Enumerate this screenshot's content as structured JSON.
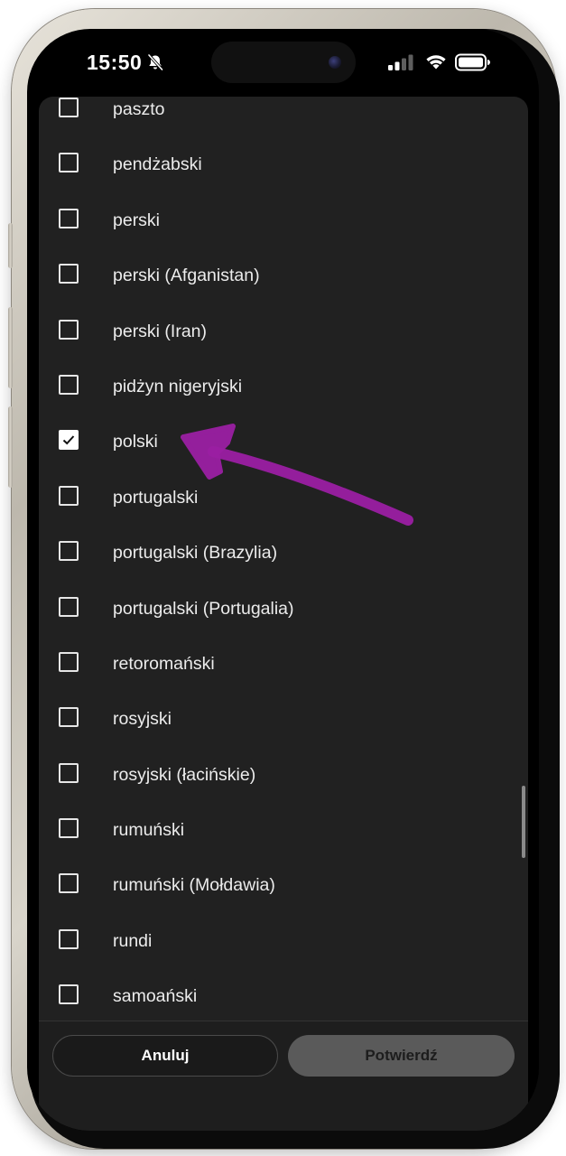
{
  "status_bar": {
    "time": "15:50",
    "icons": [
      "bell-slash-icon",
      "cellular-signal-icon",
      "wifi-icon",
      "battery-icon"
    ]
  },
  "language_list": {
    "items": [
      {
        "label": "paszto",
        "checked": false
      },
      {
        "label": "pendżabski",
        "checked": false
      },
      {
        "label": "perski",
        "checked": false
      },
      {
        "label": "perski (Afganistan)",
        "checked": false
      },
      {
        "label": "perski (Iran)",
        "checked": false
      },
      {
        "label": "pidżyn nigeryjski",
        "checked": false
      },
      {
        "label": "polski",
        "checked": true
      },
      {
        "label": "portugalski",
        "checked": false
      },
      {
        "label": "portugalski (Brazylia)",
        "checked": false
      },
      {
        "label": "portugalski (Portugalia)",
        "checked": false
      },
      {
        "label": "retoromański",
        "checked": false
      },
      {
        "label": "rosyjski",
        "checked": false
      },
      {
        "label": "rosyjski (łacińskie)",
        "checked": false
      },
      {
        "label": "rumuński",
        "checked": false
      },
      {
        "label": "rumuński (Mołdawia)",
        "checked": false
      },
      {
        "label": "rundi",
        "checked": false
      },
      {
        "label": "samoański",
        "checked": false
      }
    ]
  },
  "footer": {
    "cancel_label": "Anuluj",
    "confirm_label": "Potwierdź"
  },
  "colors": {
    "sheet_background": "#212121",
    "annotation_arrow": "#9b1fa3",
    "confirm_button_bg": "#5a5a5a"
  }
}
